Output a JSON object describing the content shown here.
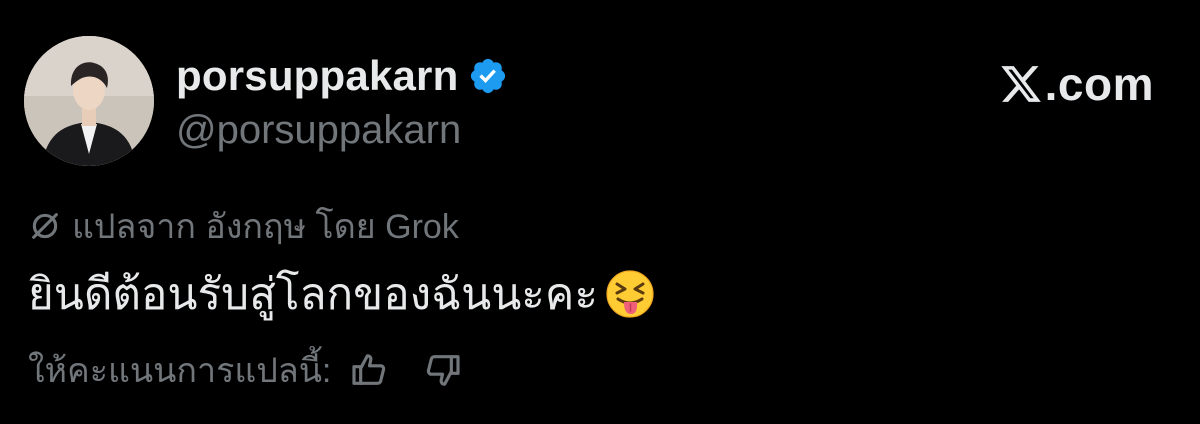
{
  "profile": {
    "display_name": "porsuppakarn",
    "handle": "@porsuppakarn",
    "verified": true
  },
  "brand": {
    "text": ".com",
    "logo_icon": "x-logo-icon"
  },
  "translation": {
    "note": "แปลจาก อังกฤษ โดย Grok",
    "icon": "translate-icon"
  },
  "tweet": {
    "text": "ยินดีต้อนรับสู่โลกของฉันนะคะ",
    "emoji": "squinting-face-with-tongue"
  },
  "rating": {
    "prompt": "ให้คะแนนการแปลนี้:",
    "up_icon": "thumbs-up-icon",
    "down_icon": "thumbs-down-icon"
  },
  "colors": {
    "background": "#000000",
    "primary_text": "#e7e9ea",
    "secondary_text": "#71767b",
    "verified_blue": "#1d9bf0"
  }
}
